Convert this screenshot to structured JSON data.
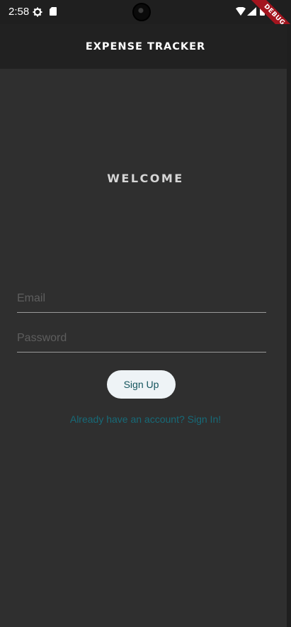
{
  "status_bar": {
    "time": "2:58",
    "icons": [
      "gear-icon",
      "sd-card-icon",
      "wifi-icon",
      "signal-icon",
      "battery-icon"
    ],
    "debug_label": "DEBUG"
  },
  "app_bar": {
    "title": "EXPENSE TRACKER"
  },
  "main": {
    "heading": "WELCOME",
    "email_field": {
      "placeholder": "Email",
      "value": ""
    },
    "password_field": {
      "placeholder": "Password",
      "value": ""
    },
    "signup_button_label": "Sign Up",
    "signin_link": "Already have an account? Sign In!"
  },
  "colors": {
    "background": "#2f2f2f",
    "app_bar": "#212121",
    "button_bg": "#eef3f6",
    "button_text": "#13545c",
    "link": "#176a78",
    "debug_ribbon": "#a3141e"
  }
}
